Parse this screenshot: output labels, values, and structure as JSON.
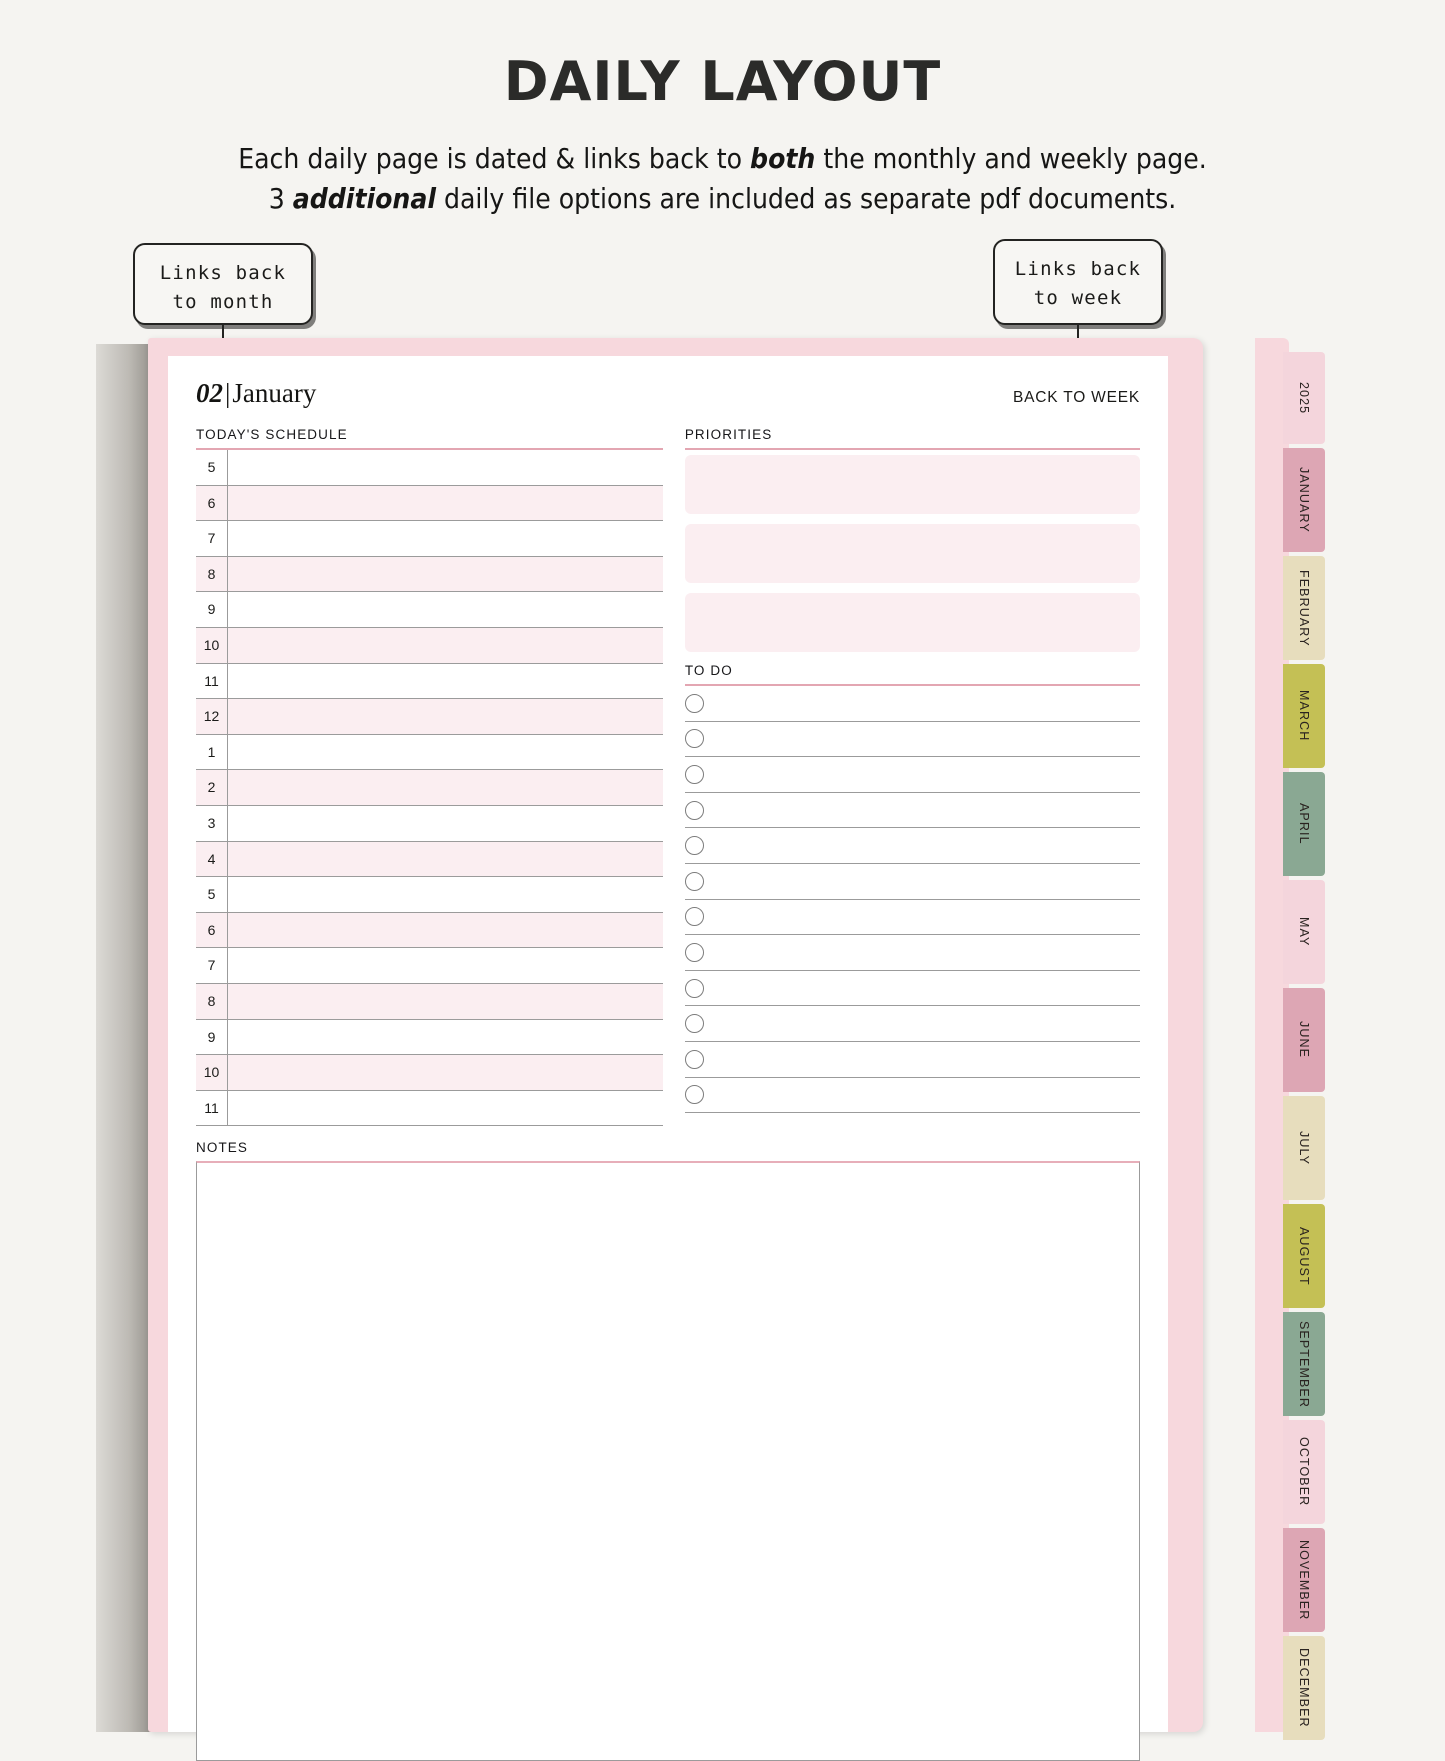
{
  "header": {
    "title": "DAILY LAYOUT",
    "subtitle_line1_a": "Each daily page is dated & links back to ",
    "subtitle_line1_b": "both",
    "subtitle_line1_c": " the monthly and weekly page.",
    "subtitle_line2_a": "3 ",
    "subtitle_line2_b": "additional",
    "subtitle_line2_c": " daily file options are included as separate pdf documents."
  },
  "callouts": {
    "month": "Links back\nto month",
    "week": "Links back\nto week"
  },
  "page": {
    "day_number": "02",
    "separator": "|",
    "month_name": "January",
    "back_to_week": "BACK TO WEEK",
    "schedule_label": "TODAY'S SCHEDULE",
    "priorities_label": "PRIORITIES",
    "todo_label": "TO DO",
    "notes_label": "NOTES",
    "schedule_hours": [
      "5",
      "6",
      "7",
      "8",
      "9",
      "10",
      "11",
      "12",
      "1",
      "2",
      "3",
      "4",
      "5",
      "6",
      "7",
      "8",
      "9",
      "10",
      "11"
    ],
    "priorities_count": 3,
    "todo_count": 12
  },
  "tabs": {
    "year": {
      "label": "2025",
      "color": "#f4d5dc"
    },
    "months": [
      {
        "label": "JANUARY",
        "color": "#dda6b4"
      },
      {
        "label": "FEBRUARY",
        "color": "#e7ddbd"
      },
      {
        "label": "MARCH",
        "color": "#c4c055"
      },
      {
        "label": "APRIL",
        "color": "#8aa893"
      },
      {
        "label": "MAY",
        "color": "#f4d5dc"
      },
      {
        "label": "JUNE",
        "color": "#dda6b4"
      },
      {
        "label": "JULY",
        "color": "#e7ddbd"
      },
      {
        "label": "AUGUST",
        "color": "#c4c055"
      },
      {
        "label": "SEPTEMBER",
        "color": "#8aa893"
      },
      {
        "label": "OCTOBER",
        "color": "#f4d5dc"
      },
      {
        "label": "NOVEMBER",
        "color": "#dda6b4"
      },
      {
        "label": "DECEMBER",
        "color": "#e7ddbd"
      }
    ]
  },
  "colors": {
    "page_bg": "#f5f4f1",
    "sheet_pink": "#f7d8dd",
    "row_tint": "#fbeef1",
    "rule_pink": "#e3a6b2",
    "line_grey": "#9b9b9b"
  }
}
